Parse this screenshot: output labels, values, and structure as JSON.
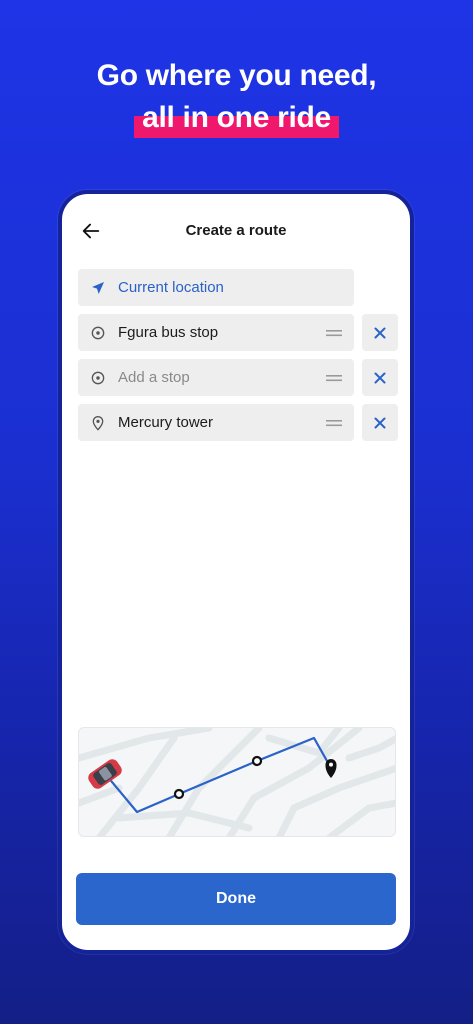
{
  "headline": {
    "line1": "Go where you need,",
    "line2": "all in one ride"
  },
  "screen": {
    "title": "Create a route",
    "back_icon": "arrow-left-icon"
  },
  "stops": [
    {
      "label": "Current location",
      "icon": "navigation-arrow-icon",
      "kind": "current"
    },
    {
      "label": "Fgura bus stop",
      "icon": "target-circle-icon",
      "kind": "stop"
    },
    {
      "label": "Add a stop",
      "icon": "target-circle-icon",
      "kind": "placeholder"
    },
    {
      "label": "Mercury tower",
      "icon": "location-pin-icon",
      "kind": "destination"
    }
  ],
  "done_label": "Done",
  "colors": {
    "background": "#1e34e6",
    "highlight": "#f0186c",
    "accent": "#2a66cc",
    "field": "#eeeeee"
  }
}
